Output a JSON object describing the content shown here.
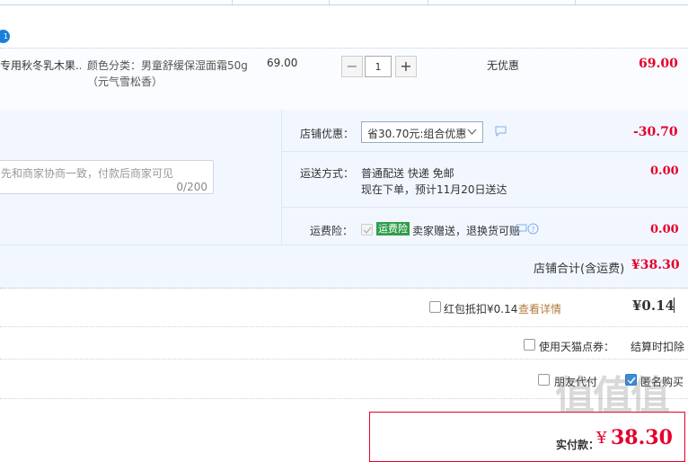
{
  "item": {
    "title": "专用秋冬乳木果...",
    "sku_label": "颜色分类：",
    "sku_value": "男童舒缓保湿面霜50g",
    "sku_extra": "（元气雪松香）",
    "unit_price": "69.00",
    "quantity": "1",
    "minus": "−",
    "plus": "+",
    "discount": "无优惠",
    "subtotal": "69.00"
  },
  "badge": "1",
  "shop": {
    "promo_label": "店铺优惠：",
    "promo_select": "省30.70元:组合优惠",
    "promo_amount": "-30.70",
    "message_placeholder": "先和商家协商一致，付款后商家可见",
    "message_count": "0/200",
    "shipping_label": "运送方式：",
    "shipping_line1": "普通配送 快递 免邮",
    "shipping_line2": "现在下单，预计11月20日送达",
    "shipping_amount": "0.00",
    "insurance_label": "运费险：",
    "insurance_tag": "运费险",
    "insurance_text": "卖家赠送，退换货可赔",
    "insurance_amount": "0.00",
    "total_label": "店铺合计(含运费)",
    "total_amount": "¥38.30"
  },
  "redpacket": {
    "label": "红包抵扣¥0.14",
    "details_link": "查看详情",
    "amount": "¥0.14"
  },
  "tmall_points": {
    "label": "使用天猫点券：",
    "note": "结算时扣除"
  },
  "options": {
    "friend_pay": "朋友代付",
    "anonymous": "匿名购买"
  },
  "payment": {
    "label": "实付款：",
    "currency": "¥",
    "amount": "38.30"
  },
  "watermark": "值值值",
  "colors": {
    "accent_red": "#e4002b",
    "link_orange": "#b47b3f",
    "panel_blue": "#f2f7ff",
    "check_blue": "#3d8bd6"
  }
}
